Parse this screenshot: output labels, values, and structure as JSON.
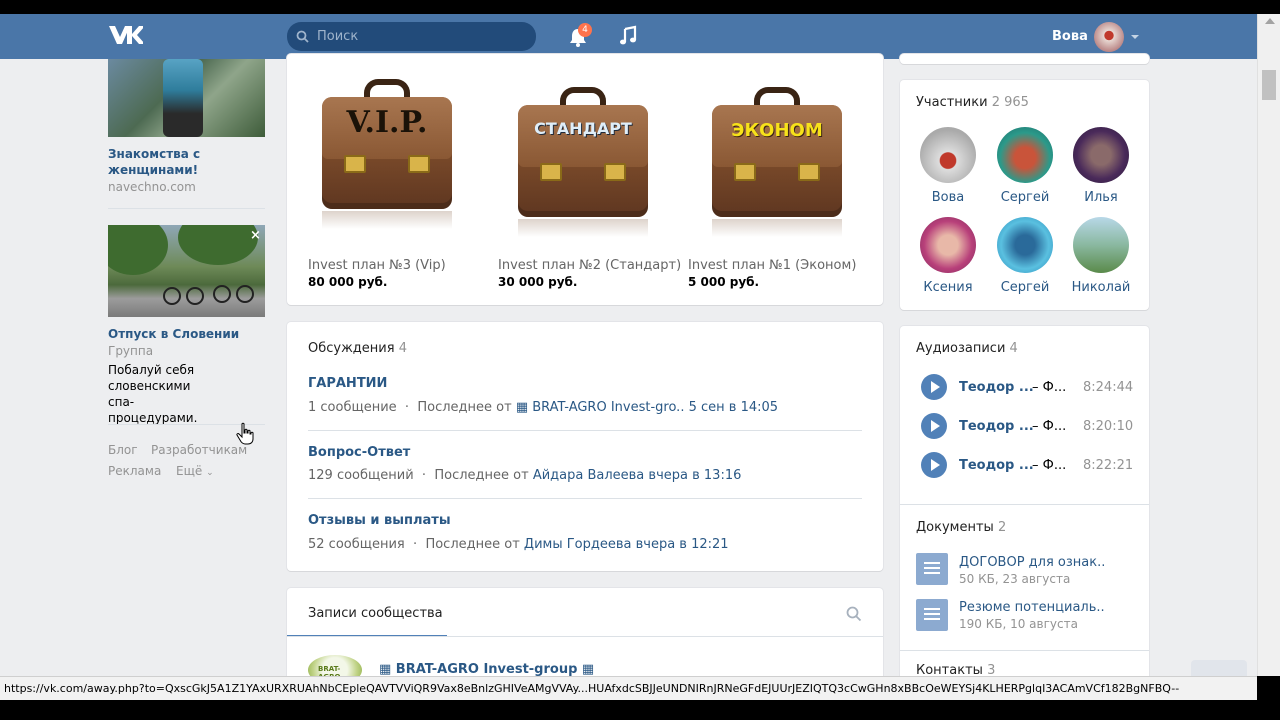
{
  "header": {
    "search_placeholder": "Поиск",
    "notification_count": "4",
    "user_name": "Вова"
  },
  "left_ads": {
    "ad1": {
      "title": "Знакомства с женщинами!",
      "domain": "navechno.com"
    },
    "ad2": {
      "title": "Отпуск в Словении",
      "type": "Группа",
      "text": "Побалуй себя словенскими спа-процедурами.",
      "close": "×"
    },
    "footer": {
      "blog": "Блог",
      "dev": "Разработчикам",
      "ads": "Реклама",
      "more": "Ещё"
    }
  },
  "plans": [
    {
      "label": "V.I.P.",
      "name": "Invest план №3 (Vip)",
      "price": "80 000 руб."
    },
    {
      "label": "СТАНДАРТ",
      "name": "Invest план №2 (Стандарт)",
      "price": "30 000 руб."
    },
    {
      "label": "ЭКОНОМ",
      "name": "Invest план №1 (Эконом)",
      "price": "5 000 руб."
    }
  ],
  "discussions": {
    "title": "Обсуждения",
    "count": "4",
    "topics": [
      {
        "title": "ГАРАНТИИ",
        "count": "1 сообщение",
        "last_prefix": "Последнее от",
        "last_author": "▦ BRAT-AGRO Invest-gro..",
        "last_time": "5 сен в 14:05"
      },
      {
        "title": "Вопрос-Ответ",
        "count": "129 сообщений",
        "last_prefix": "Последнее от",
        "last_author": "Айдара Валеева",
        "last_time": "вчера в 13:16"
      },
      {
        "title": "Отзывы и выплаты",
        "count": "52 сообщения",
        "last_prefix": "Последнее от",
        "last_author": "Димы Гордеева",
        "last_time": "вчера в 12:21"
      }
    ]
  },
  "wall": {
    "tab": "Записи сообщества",
    "post_author": "▦ BRAT-AGRO Invest-group ▦",
    "logo_text": "BRAT-AGRO"
  },
  "members": {
    "title": "Участники",
    "count": "2 965",
    "list": [
      {
        "name": "Вова"
      },
      {
        "name": "Сергей"
      },
      {
        "name": "Илья"
      },
      {
        "name": "Ксения"
      },
      {
        "name": "Сергей"
      },
      {
        "name": "Николай"
      }
    ]
  },
  "audio": {
    "title": "Аудиозаписи",
    "count": "4",
    "tracks": [
      {
        "artist": "Теодор ...",
        "title": "– Ф...",
        "duration": "8:24:44"
      },
      {
        "artist": "Теодор ...",
        "title": "– Ф...",
        "duration": "8:20:10"
      },
      {
        "artist": "Теодор ...",
        "title": "– Ф...",
        "duration": "8:22:21"
      }
    ]
  },
  "documents": {
    "title": "Документы",
    "count": "2",
    "list": [
      {
        "name": "ДОГОВОР для ознак..",
        "meta": "50 КБ, 23 августа"
      },
      {
        "name": "Резюме потенциаль..",
        "meta": "190 КБ, 10 августа"
      }
    ]
  },
  "contacts": {
    "title": "Контакты",
    "count": "3"
  },
  "statusbar": "https://vk.com/away.php?to=QxscGkJ5A1Z1YAxURXRUAhNbCEpleQAVTVViQR9Vax8eBnlzGHIVeAMgVVAy...HUAfxdcSBJJeUNDNIRnJRNeGFdEJUUrJEZIQTQ3cCwGHn8xBBcOeWEYSj4KLHERPglqI3ACAmVCf182BgNFBQ--"
}
